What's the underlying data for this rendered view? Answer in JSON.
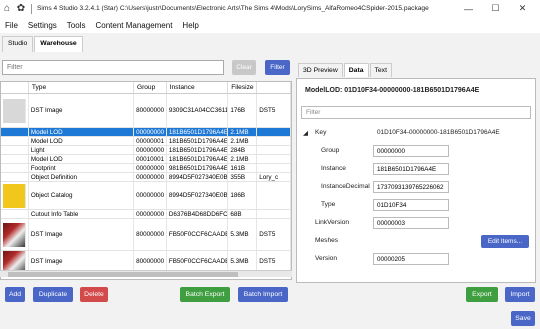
{
  "window": {
    "title": "Sims 4 Studio 3.2.4.1 (Star)  C:\\Users\\justr\\Documents\\Electronic Arts\\The Sims 4\\Mods\\LorySims_AlfaRomeo4CSpider-2015.package",
    "minimize": "—",
    "maximize": "☐",
    "close": "✕"
  },
  "menu": [
    "File",
    "Settings",
    "Tools",
    "Content Management",
    "Help"
  ],
  "left_tabs": [
    "Studio",
    "Warehouse"
  ],
  "filter": {
    "placeholder": "Filter",
    "clear_label": "Clear",
    "filter_label": "Filter"
  },
  "grid": {
    "headers": [
      "",
      "Type",
      "Group",
      "Instance",
      "Filesize",
      ""
    ],
    "rows": [
      {
        "thumb": "grey",
        "type": "DST Image",
        "group": "80000000",
        "instance": "9309C31A04CC3611",
        "filesize": "176B",
        "extra": "DST5"
      },
      {
        "thumb": "",
        "type": "Model LOD",
        "group": "00000000",
        "instance": "181B6501D1796A4E",
        "filesize": "2.1MB",
        "extra": "",
        "selected": true
      },
      {
        "thumb": "",
        "type": "Model LOD",
        "group": "00000001",
        "instance": "181B6501D1796A4E",
        "filesize": "2.1MB",
        "extra": ""
      },
      {
        "thumb": "",
        "type": "Light",
        "group": "00000000",
        "instance": "181B6501D1796A4E",
        "filesize": "284B",
        "extra": ""
      },
      {
        "thumb": "",
        "type": "Model LOD",
        "group": "00010001",
        "instance": "181B6501D1796A4E",
        "filesize": "2.1MB",
        "extra": ""
      },
      {
        "thumb": "",
        "type": "Footprint",
        "group": "00000000",
        "instance": "981B6501D1796A4E",
        "filesize": "161B",
        "extra": ""
      },
      {
        "thumb": "",
        "type": "Object Definition",
        "group": "00000000",
        "instance": "8994D5F027340E0B",
        "filesize": "355B",
        "extra": "Lory_c"
      },
      {
        "thumb": "yellow",
        "type": "Object Catalog",
        "group": "00000000",
        "instance": "8994D5F027340E0B",
        "filesize": "186B",
        "extra": ""
      },
      {
        "thumb": "",
        "type": "Cutout Info Table",
        "group": "00000000",
        "instance": "D6376B4D68DD6FC0",
        "filesize": "68B",
        "extra": ""
      },
      {
        "thumb": "photo",
        "type": "DST Image",
        "group": "80000000",
        "instance": "FB50F0CCF6CAADB5",
        "filesize": "5.3MB",
        "extra": "DST5"
      },
      {
        "thumb": "photo",
        "type": "DST Image",
        "group": "80000000",
        "instance": "FB50F0CCF6CAADB5",
        "filesize": "5.3MB",
        "extra": "DST5"
      }
    ]
  },
  "right_tabs": [
    "3D Preview",
    "Data",
    "Text"
  ],
  "props": {
    "title": "ModelLOD: 01D10F34-00000000-181B6501D1796A4E",
    "search_placeholder": "Filter",
    "key_label": "Key",
    "key_value": "01D10F34-00000000-181B6501D1796A4E",
    "group_label": "Group",
    "group_value": "00000000",
    "instance_label": "Instance",
    "instance_value": "181B6501D1796A4E",
    "instance_decimal_label": "InstanceDecimal",
    "instance_decimal_value": "1737093139765226062",
    "type_label": "Type",
    "type_value": "01D10F34",
    "link_label": "LinkVersion",
    "link_value": "00000003",
    "meshes_label": "Meshes",
    "edit_label": "Edit Items...",
    "version_label": "Version",
    "version_value": "00000205"
  },
  "buttons": {
    "add": "Add",
    "duplicate": "Duplicate",
    "delete": "Delete",
    "batch_export": "Batch Export",
    "batch_import": "Batch Import",
    "export": "Export",
    "import": "Import",
    "save": "Save"
  }
}
